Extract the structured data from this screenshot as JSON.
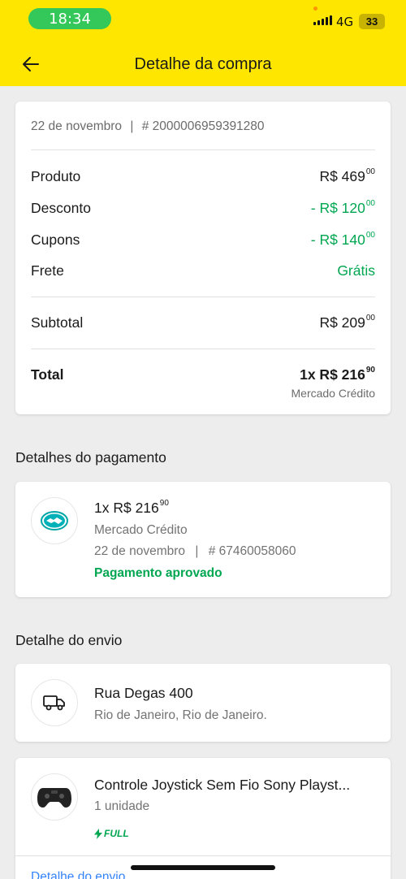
{
  "status_bar": {
    "time": "18:34",
    "network": "4G",
    "battery": "33"
  },
  "header": {
    "title": "Detalhe da compra",
    "back_icon": "arrow-left-icon"
  },
  "summary": {
    "date": "22 de novembro",
    "separator": "|",
    "order_number": "# 2000006959391280",
    "rows": [
      {
        "label": "Produto",
        "value": "R$ 469",
        "cents": "00",
        "color": "#1a1a1a"
      },
      {
        "label": "Desconto",
        "value": "- R$ 120",
        "cents": "00",
        "color": "#00a650"
      },
      {
        "label": "Cupons",
        "value": "- R$ 140",
        "cents": "00",
        "color": "#00a650"
      },
      {
        "label": "Frete",
        "value": "Grátis",
        "cents": "",
        "color": "#00a650"
      }
    ],
    "subtotal": {
      "label": "Subtotal",
      "value": "R$ 209",
      "cents": "00"
    },
    "total": {
      "label": "Total",
      "value": "1x R$ 216",
      "cents": "90",
      "method": "Mercado Crédito"
    }
  },
  "payment": {
    "section_title": "Detalhes do pagamento",
    "icon": "handshake-icon",
    "amount": "1x R$ 216",
    "cents": "90",
    "method": "Mercado Crédito",
    "date": "22 de novembro",
    "separator": "|",
    "transaction": "# 67460058060",
    "status": "Pagamento aprovado"
  },
  "shipping": {
    "section_title": "Detalhe do envio",
    "icon": "truck-icon",
    "address": "Rua Degas 400",
    "city": "Rio de Janeiro, Rio de Janeiro."
  },
  "product": {
    "name": "Controle Joystick Sem Fio Sony Playst...",
    "quantity": "1 unidade",
    "badge": "FULL",
    "badge_icon": "lightning-icon",
    "link": "Detalhe do envio"
  },
  "colors": {
    "brand_yellow": "#ffe600",
    "success_green": "#00a650",
    "link_blue": "#3483fa"
  }
}
